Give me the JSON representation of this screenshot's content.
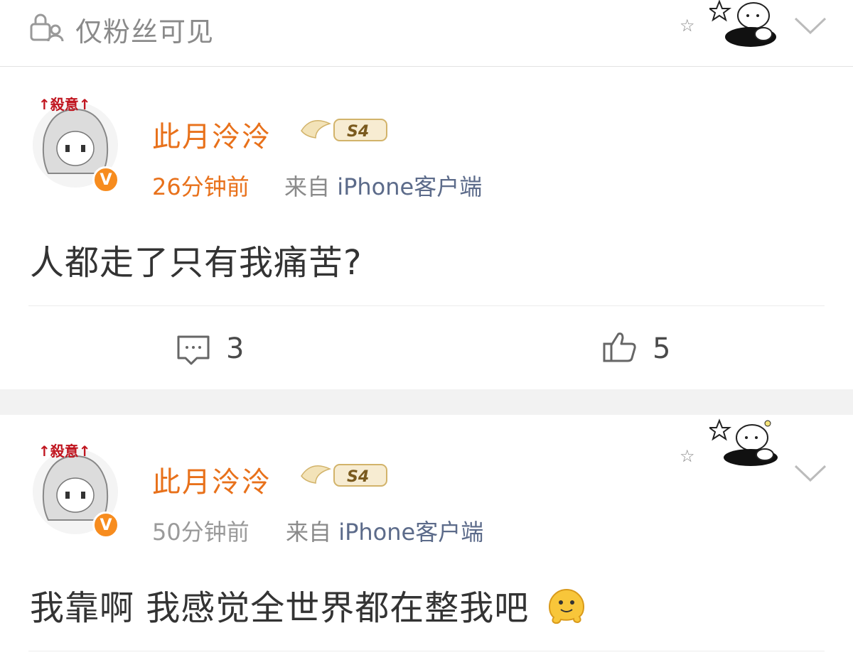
{
  "top": {
    "visibility_icon": "lock-person-icon",
    "visibility_text": "仅粉丝可见"
  },
  "posts": [
    {
      "username": "此月泠泠",
      "avatar_text": "↑殺意↑",
      "verified_icon": "v-badge-icon",
      "level_badge": "S4",
      "time": "26分钟前",
      "source_prefix": "来自",
      "source_device": "iPhone客户端",
      "content": "人都走了只有我痛苦?",
      "comment_count": "3",
      "like_count": "5",
      "time_color": "#e8711b"
    },
    {
      "username": "此月泠泠",
      "avatar_text": "↑殺意↑",
      "verified_icon": "v-badge-icon",
      "level_badge": "S4",
      "time": "50分钟前",
      "source_prefix": "来自",
      "source_device": "iPhone客户端",
      "content": "我靠啊 我感觉全世界都在整我吧",
      "time_color": "#9a9a9a"
    }
  ],
  "colors": {
    "accent": "#e8711b",
    "verified": "#f78c1e",
    "separator": "#f2f2f2"
  }
}
